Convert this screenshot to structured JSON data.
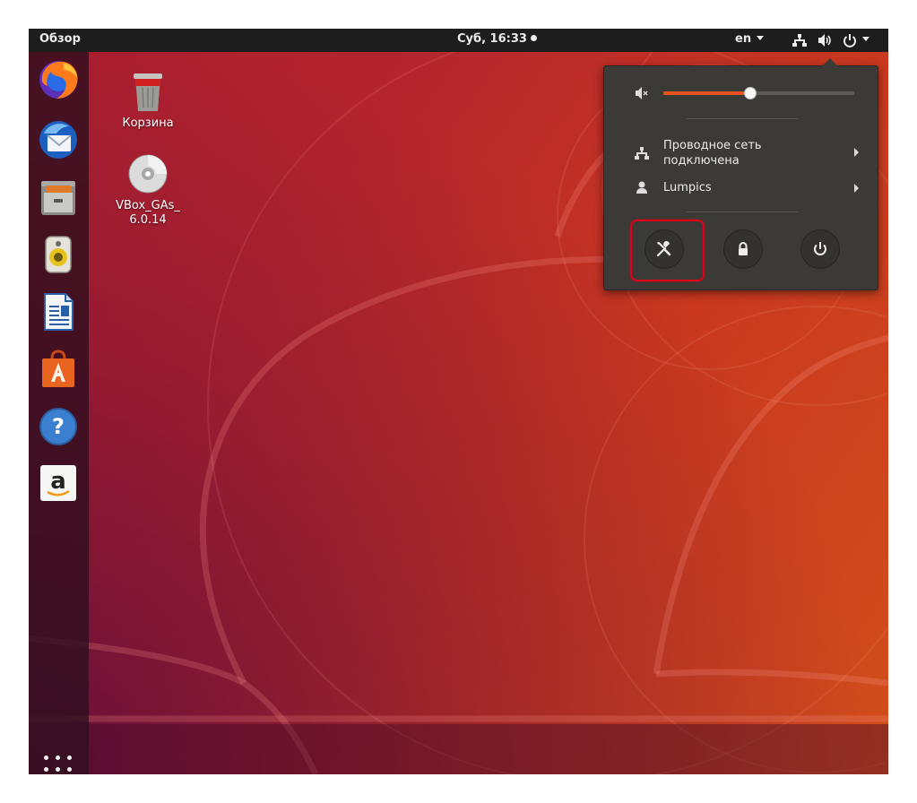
{
  "topbar": {
    "activities": "Обзор",
    "clock": "Суб, 16:33",
    "language": "en"
  },
  "dock": {
    "items": [
      "firefox-icon",
      "thunderbird-icon",
      "files-icon",
      "rhythmbox-icon",
      "libreoffice-writer-icon",
      "software-center-icon",
      "help-icon",
      "amazon-icon"
    ]
  },
  "desktop": {
    "trash_label": "Корзина",
    "cd_label_line1": "VBox_GAs_",
    "cd_label_line2": "6.0.14"
  },
  "system_menu": {
    "volume_level": 0.45,
    "network_label_line1": "Проводное сеть",
    "network_label_line2": "подключена",
    "user_label": "Lumpics",
    "buttons": [
      "settings-icon",
      "lock-icon",
      "power-icon"
    ]
  },
  "colors": {
    "accent": "#e95420",
    "highlight": "#e0001a"
  }
}
